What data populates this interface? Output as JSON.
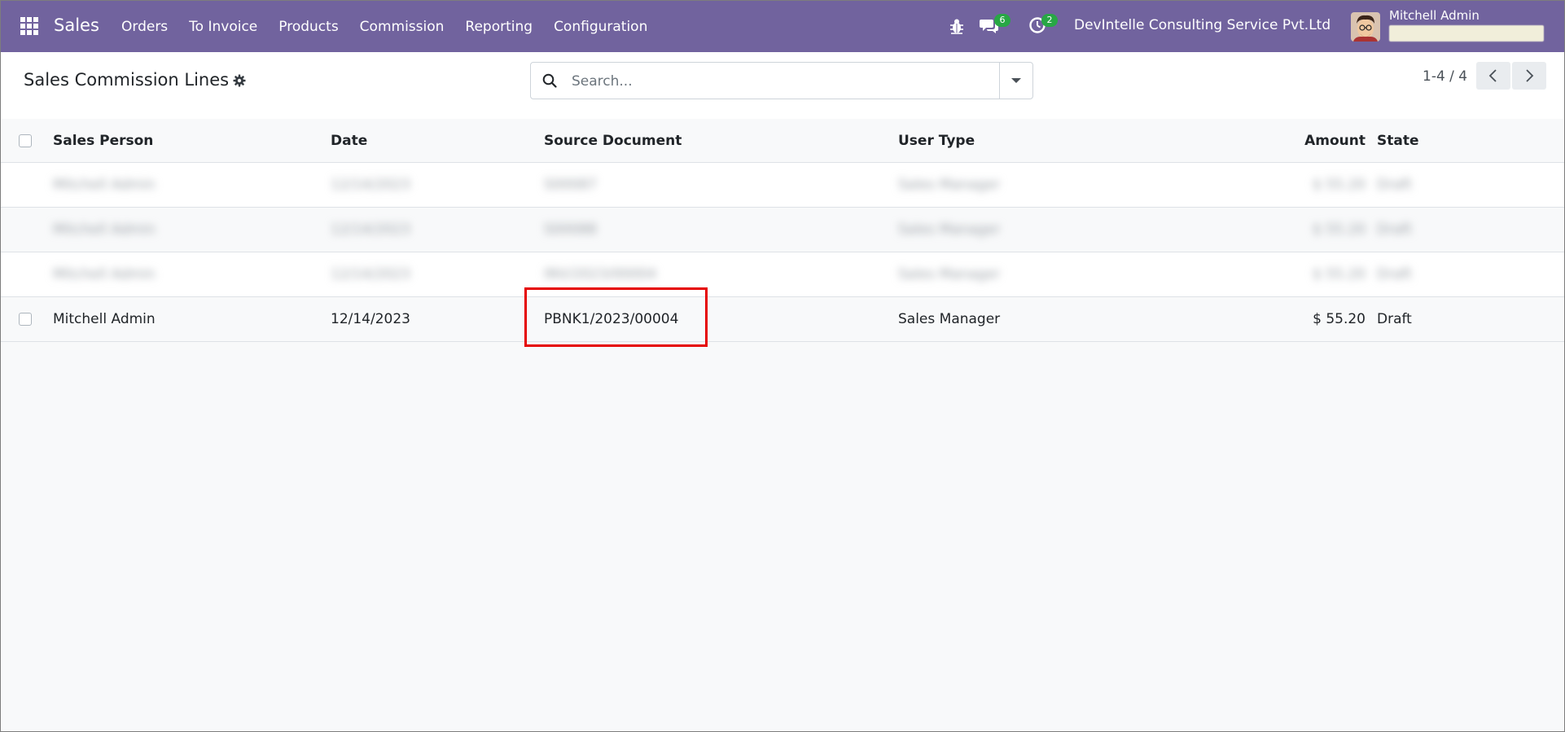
{
  "navbar": {
    "brand": "Sales",
    "menu": [
      "Orders",
      "To Invoice",
      "Products",
      "Commission",
      "Reporting",
      "Configuration"
    ],
    "messages_count": "6",
    "activities_count": "2",
    "company": "DevIntelle Consulting Service Pvt.Ltd",
    "user_name": "Mitchell Admin"
  },
  "control_panel": {
    "title": "Sales Commission Lines",
    "search_placeholder": "Search...",
    "pager": "1-4 / 4"
  },
  "list": {
    "columns": {
      "sales_person": "Sales Person",
      "date": "Date",
      "source_document": "Source Document",
      "user_type": "User Type",
      "amount": "Amount",
      "state": "State"
    },
    "blurred_rows": [
      {
        "sales_person": "Mitchell Admin",
        "date": "12/14/2023",
        "source_document": "S00087",
        "user_type": "Sales Manager",
        "amount": "$ 55.20",
        "state": "Draft"
      },
      {
        "sales_person": "Mitchell Admin",
        "date": "12/14/2023",
        "source_document": "S00088",
        "user_type": "Sales Manager",
        "amount": "$ 55.20",
        "state": "Draft"
      },
      {
        "sales_person": "Mitchell Admin",
        "date": "12/14/2023",
        "source_document": "INV/2023/00004",
        "user_type": "Sales Manager",
        "amount": "$ 55.20",
        "state": "Draft"
      }
    ],
    "rows": [
      {
        "sales_person": "Mitchell Admin",
        "date": "12/14/2023",
        "source_document": "PBNK1/2023/00004",
        "user_type": "Sales Manager",
        "amount": "$ 55.20",
        "state": "Draft"
      }
    ]
  },
  "colors": {
    "navbar": "#71639e",
    "badge": "#28a745",
    "highlight": "#e50000"
  }
}
